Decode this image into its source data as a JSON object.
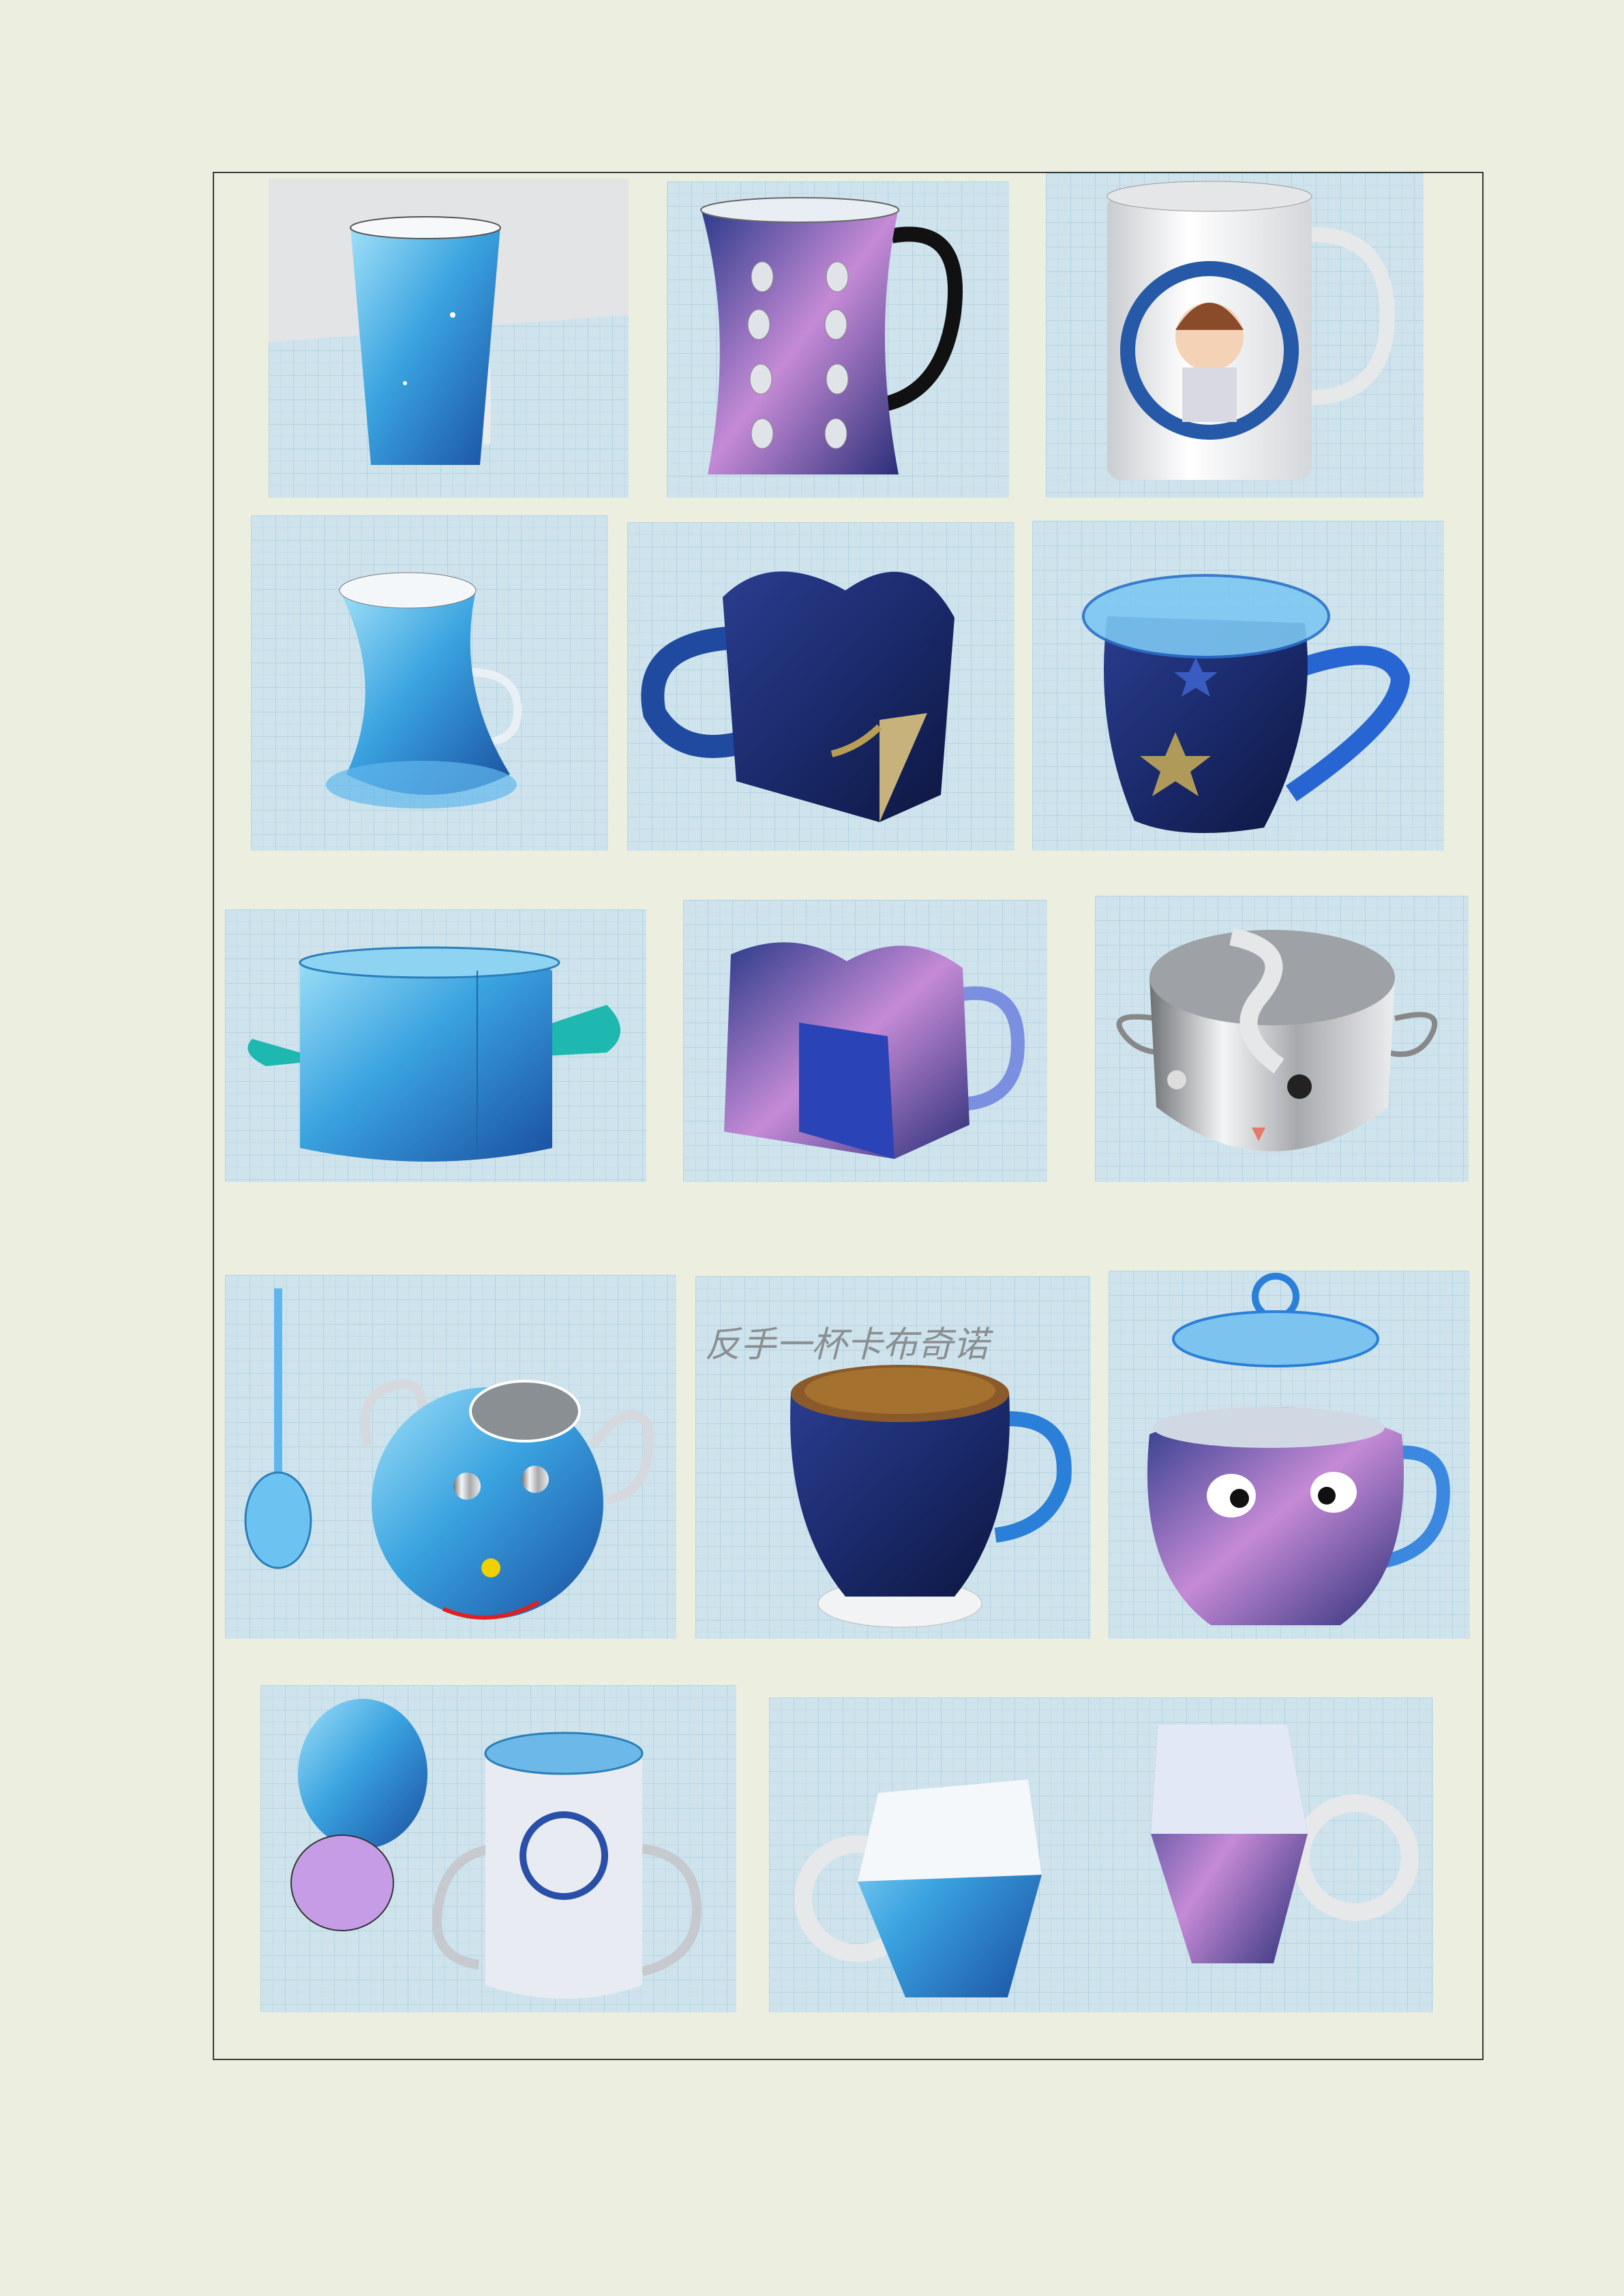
{
  "page": {
    "background": "#ecefe0",
    "frame_color": "#3a3a3a"
  },
  "palette": {
    "grid_bg": "#cfe3ec",
    "grid_line": "#a9cfe0",
    "galaxy_dark": "#1a2a6b",
    "galaxy_light": "#7fd2f5",
    "galaxy_pink": "#e6a6de",
    "chrome": "#d7d9db",
    "teal": "#1eb8b0"
  },
  "gallery": {
    "items": [
      {
        "icon": "tall-tumbler-cup-icon"
      },
      {
        "icon": "waisted-mug-with-holes-icon"
      },
      {
        "icon": "anime-print-mug-icon"
      },
      {
        "icon": "flared-base-cup-icon"
      },
      {
        "icon": "heart-shaped-mug-icon"
      },
      {
        "icon": "lidded-star-mug-icon"
      },
      {
        "icon": "heart-cup-with-wings-icon"
      },
      {
        "icon": "heart-galaxy-mug-icon"
      },
      {
        "icon": "chrome-yin-yang-cup-icon"
      },
      {
        "icon": "face-bowl-with-spoon-icon"
      },
      {
        "icon": "coffee-cup-icon"
      },
      {
        "icon": "eyes-mug-with-lid-icon"
      },
      {
        "icon": "flower-cup-with-lid-icon"
      },
      {
        "icon": "hexagonal-mugs-pair-icon"
      }
    ],
    "coffee_caption": "反手一杯卡布奇诺"
  }
}
